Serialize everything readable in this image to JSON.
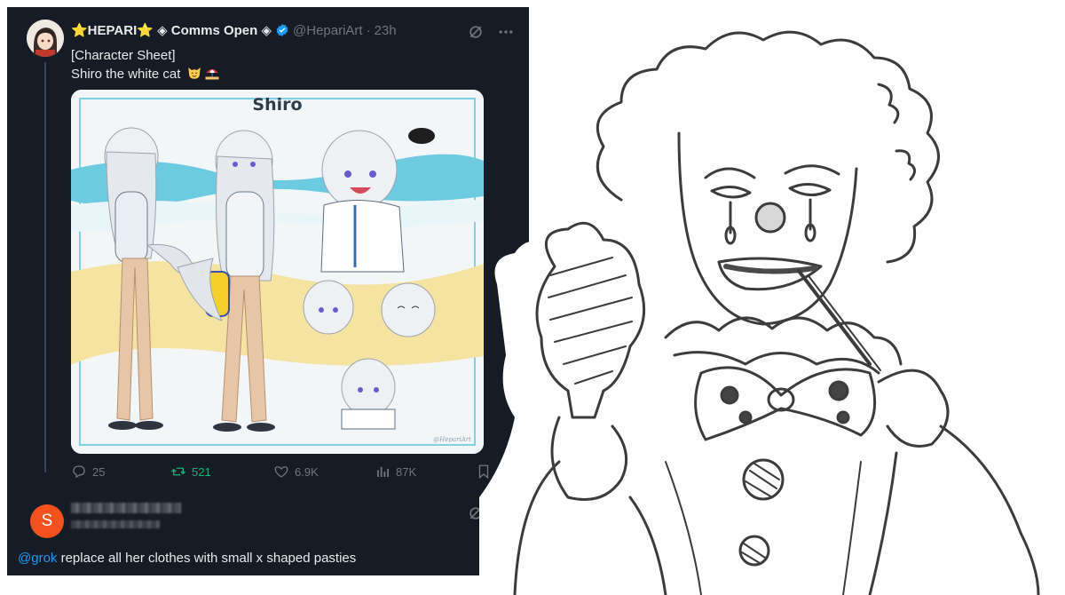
{
  "tweet": {
    "display_name": "⭐HEPARI⭐ ◈ Comms Open ◈",
    "handle": "@HepariArt",
    "separator": "·",
    "time": "23h",
    "text_line1": "[Character Sheet]",
    "text_line2": "Shiro the white cat",
    "media": {
      "title": "Shiro",
      "signature": "@HepariArt"
    },
    "actions": {
      "replies": "25",
      "retweets": "521",
      "likes": "6.9K",
      "views": "87K"
    }
  },
  "reply": {
    "avatar_letter": "S",
    "mention": "@grok",
    "text": " replace all her clothes with small x shaped pasties"
  },
  "colors": {
    "panel_bg": "#151c25",
    "text": "#e7e9ea",
    "muted": "#71767b",
    "link": "#1d9bf0",
    "retweet_green": "#00ba7c",
    "verified": "#1d9bf0",
    "reply_avatar": "#f4511e"
  },
  "icons": [
    "verified-badge-icon",
    "grok-icon",
    "more-icon",
    "reply-icon",
    "retweet-icon",
    "like-icon",
    "views-icon",
    "bookmark-icon",
    "share-icon"
  ]
}
